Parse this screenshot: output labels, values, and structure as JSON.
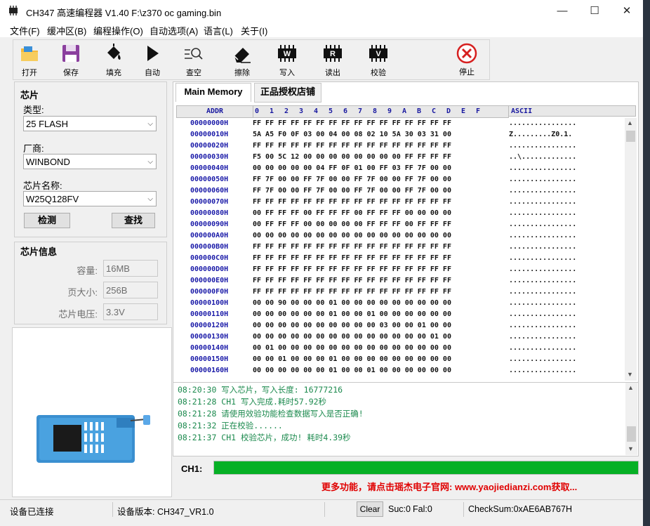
{
  "window": {
    "title": "CH347 高速编程器  V1.40    F:\\z370 oc gaming.bin",
    "controls": {
      "minimize": "—",
      "maximize": "☐",
      "close": "✕"
    }
  },
  "menu": [
    "文件(F)",
    "缓冲区(B)",
    "编程操作(O)",
    "自动选项(A)",
    "语言(L)",
    "关于(I)"
  ],
  "toolbar": {
    "open": "打开",
    "save": "保存",
    "fill": "填充",
    "auto": "自动",
    "lookup": "查空",
    "erase": "擦除",
    "write": "写入",
    "read": "读出",
    "verify": "校验",
    "stop": "停止",
    "write_glyph": "W",
    "read_glyph": "R",
    "verify_glyph": "V"
  },
  "chip": {
    "title": "芯片",
    "type_label": "类型:",
    "type_value": "25 FLASH",
    "vendor_label": "厂商:",
    "vendor_value": "WINBOND",
    "name_label": "芯片名称:",
    "name_value": "W25Q128FV",
    "detect_button": "检测",
    "find_button": "查找"
  },
  "chip_info": {
    "title": "芯片信息",
    "capacity_label": "容量:",
    "capacity_value": "16MB",
    "page_label": "页大小:",
    "page_value": "256B",
    "voltage_label": "芯片电压:",
    "voltage_value": "3.3V"
  },
  "tabs": {
    "main_memory": "Main Memory",
    "store": "正品授权店铺"
  },
  "hex": {
    "addr_header": "ADDR",
    "columns": [
      "0",
      "1",
      "2",
      "3",
      "4",
      "5",
      "6",
      "7",
      "8",
      "9",
      "A",
      "B",
      "C",
      "D",
      "E",
      "F"
    ],
    "ascii_header": "ASCII",
    "rows": [
      {
        "addr": "00000000H",
        "bytes": "FF FF FF FF FF FF FF FF FF FF FF FF FF FF FF FF",
        "ascii": "................"
      },
      {
        "addr": "00000010H",
        "bytes": "5A A5 F0 0F 03 00 04 00 08 02 10 5A 30 03 31 00",
        "ascii": "Z.........Z0.1."
      },
      {
        "addr": "00000020H",
        "bytes": "FF FF FF FF FF FF FF FF FF FF FF FF FF FF FF FF",
        "ascii": "................"
      },
      {
        "addr": "00000030H",
        "bytes": "F5 00 5C 12 00 00 00 00 00 00 00 00 FF FF FF FF",
        "ascii": "..\\............."
      },
      {
        "addr": "00000040H",
        "bytes": "00 00 00 00 00 04 FF 0F 01 00 FF 03 FF 7F 00 00",
        "ascii": "................"
      },
      {
        "addr": "00000050H",
        "bytes": "FF 7F 00 00 FF 7F 00 00 FF 7F 00 00 FF 7F 00 00",
        "ascii": "................"
      },
      {
        "addr": "00000060H",
        "bytes": "FF 7F 00 00 FF 7F 00 00 FF 7F 00 00 FF 7F 00 00",
        "ascii": "................"
      },
      {
        "addr": "00000070H",
        "bytes": "FF FF FF FF FF FF FF FF FF FF FF FF FF FF FF FF",
        "ascii": "................"
      },
      {
        "addr": "00000080H",
        "bytes": "00 FF FF FF 00 FF FF FF 00 FF FF FF 00 00 00 00",
        "ascii": "................"
      },
      {
        "addr": "00000090H",
        "bytes": "00 FF FF FF 00 00 00 00 00 FF FF FF 00 FF FF FF",
        "ascii": "................"
      },
      {
        "addr": "000000A0H",
        "bytes": "00 00 00 00 00 00 00 00 00 00 00 00 00 00 00 00",
        "ascii": "................"
      },
      {
        "addr": "000000B0H",
        "bytes": "FF FF FF FF FF FF FF FF FF FF FF FF FF FF FF FF",
        "ascii": "................"
      },
      {
        "addr": "000000C0H",
        "bytes": "FF FF FF FF FF FF FF FF FF FF FF FF FF FF FF FF",
        "ascii": "................"
      },
      {
        "addr": "000000D0H",
        "bytes": "FF FF FF FF FF FF FF FF FF FF FF FF FF FF FF FF",
        "ascii": "................"
      },
      {
        "addr": "000000E0H",
        "bytes": "FF FF FF FF FF FF FF FF FF FF FF FF FF FF FF FF",
        "ascii": "................"
      },
      {
        "addr": "000000F0H",
        "bytes": "FF FF FF FF FF FF FF FF FF FF FF FF FF FF FF FF",
        "ascii": "................"
      },
      {
        "addr": "00000100H",
        "bytes": "00 00 90 00 00 00 01 00 00 00 00 00 00 00 00 00",
        "ascii": "................"
      },
      {
        "addr": "00000110H",
        "bytes": "00 00 00 00 00 00 01 00 00 01 00 00 00 00 00 00",
        "ascii": "................"
      },
      {
        "addr": "00000120H",
        "bytes": "00 00 00 00 00 00 00 00 00 00 03 00 00 01 00 00",
        "ascii": "................"
      },
      {
        "addr": "00000130H",
        "bytes": "00 00 00 00 00 00 00 00 00 00 00 00 00 00 01 00",
        "ascii": "................"
      },
      {
        "addr": "00000140H",
        "bytes": "00 01 00 00 00 00 00 00 00 00 00 00 00 00 00 00",
        "ascii": "................"
      },
      {
        "addr": "00000150H",
        "bytes": "00 00 01 00 00 00 01 00 00 00 00 00 00 00 00 00",
        "ascii": "................"
      },
      {
        "addr": "00000160H",
        "bytes": "00 00 00 00 00 00 01 00 00 01 00 00 00 00 00 00",
        "ascii": "................"
      }
    ]
  },
  "log": [
    "08:20:30 写入芯片，写入长度: 16777216",
    "08:21:28 CH1 写入完成.耗时57.92秒",
    "08:21:28 请使用效验功能检查数据写入是否正确!",
    "08:21:32 正在校验......",
    "08:21:37 CH1 校验芯片，成功! 耗时4.39秒"
  ],
  "progress": {
    "label": "CH1:",
    "fraction": 1.0,
    "color": "#06b025"
  },
  "promo": "更多功能，请点击瑶杰电子官网: www.yaojiedianzi.com获取...",
  "status": {
    "connection": "设备已连接",
    "device_version": "设备版本:  CH347_VR1.0",
    "clear_button": "Clear",
    "suc": "Suc:0",
    "fal": "Fal:0",
    "checksum": "CheckSum:0xAE6AB767H"
  },
  "colors": {
    "stop_red": "#d62020",
    "log_green": "#1c8a4e",
    "addr_blue": "#1a1aa8",
    "promo_red": "#e00000"
  }
}
